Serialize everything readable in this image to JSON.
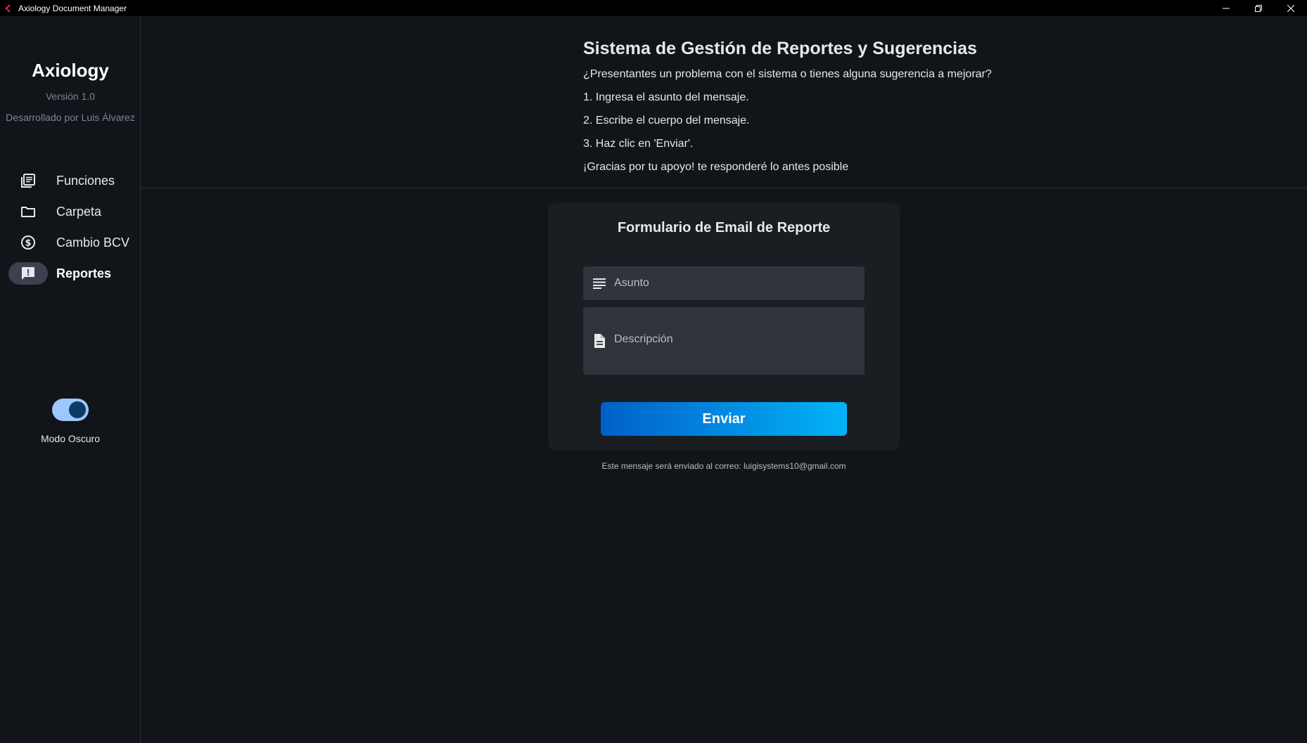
{
  "window": {
    "title": "Axiology Document Manager",
    "controls": [
      "minimize",
      "restore",
      "close"
    ]
  },
  "sidebar": {
    "brand": "Axiology",
    "version": "Versión 1.0",
    "developer": "Desarrollado por Luis Álvarez",
    "items": [
      {
        "label": "Funciones",
        "icon": "library-books-icon",
        "active": false
      },
      {
        "label": "Carpeta",
        "icon": "folder-icon",
        "active": false
      },
      {
        "label": "Cambio BCV",
        "icon": "dollar-circle-icon",
        "active": false
      },
      {
        "label": "Reportes",
        "icon": "feedback-icon",
        "active": true
      }
    ],
    "theme_toggle": {
      "label": "Modo Oscuro",
      "on": true
    }
  },
  "header": {
    "title": "Sistema de Gestión de Reportes y Sugerencias",
    "lines": [
      "¿Presentantes un problema con el sistema o tienes alguna sugerencia a mejorar?",
      "1. Ingresa el asunto del mensaje.",
      "2. Escribe el cuerpo del mensaje.",
      "3. Haz clic en 'Enviar'.",
      "¡Gracias por tu apoyo! te responderé lo antes posible"
    ]
  },
  "form": {
    "title": "Formulario de Email de Reporte",
    "subject": {
      "placeholder": "Asunto",
      "value": "",
      "icon": "subject-lines-icon"
    },
    "description": {
      "placeholder": "Descripción",
      "value": "",
      "icon": "document-icon"
    },
    "submit_label": "Enviar",
    "footnote": "Este mensaje será enviado al correo: luigisystems10@gmail.com"
  },
  "colors": {
    "background": "#111418",
    "card": "#1a1d22",
    "field": "#30333a",
    "button_gradient_start": "#0060c9",
    "button_gradient_end": "#03b3f7",
    "toggle_track": "#9ec6ff",
    "toggle_knob": "#0b3b66"
  }
}
